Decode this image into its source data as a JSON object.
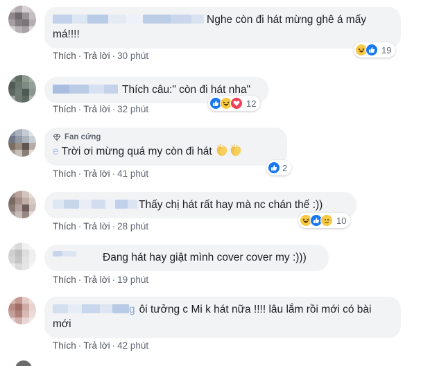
{
  "comments": [
    {
      "text": "Nghe còn đi hát mừng ghê á mấy má!!!!",
      "line1": "Nghe còn đi hát mừng ghê á mấy",
      "line2": "má!!!!",
      "like_label": "Thích",
      "reply_label": "Trả lời",
      "time": "30 phút",
      "reaction_count": "19",
      "reactions": [
        "haha-icon",
        "like-icon"
      ]
    },
    {
      "text": "Thích câu:\" còn đi hát nha\"",
      "like_label": "Thích",
      "reply_label": "Trả lời",
      "time": "32 phút",
      "reaction_count": "12",
      "reactions": [
        "like-icon",
        "haha-icon",
        "love-icon"
      ]
    },
    {
      "badge": "Fan cứng",
      "name_fragment": "e",
      "text": "Trời ơi mừng quá my còn đi hát",
      "like_label": "Thích",
      "reply_label": "Trả lời",
      "time": "41 phút",
      "reaction_count": "2",
      "reactions": [
        "like-icon"
      ]
    },
    {
      "text": "Thấy chị hát rất hay mà nc chán thế :))",
      "like_label": "Thích",
      "reply_label": "Trả lời",
      "time": "28 phút",
      "reaction_count": "10",
      "reactions": [
        "haha-icon",
        "like-icon",
        "sad-icon"
      ]
    },
    {
      "text": "Đang hát hay giật mình cover cover my :)))",
      "like_label": "Thích",
      "reply_label": "Trả lời",
      "time": "19 phút"
    },
    {
      "name_fragment": "g",
      "line1": "ôi tưởng c Mi k hát nữa !!!! lâu lắm rồi mới có bài",
      "line2": "mới",
      "like_label": "Thích",
      "reply_label": "Trả lời",
      "time": "42 phút"
    }
  ],
  "separator": "·",
  "colors": {
    "bubble": "#f2f3f5",
    "action_text": "#606770",
    "like_blue": "#1877f2",
    "haha_yellow": "#f7c945",
    "love_red": "#f33e58"
  }
}
